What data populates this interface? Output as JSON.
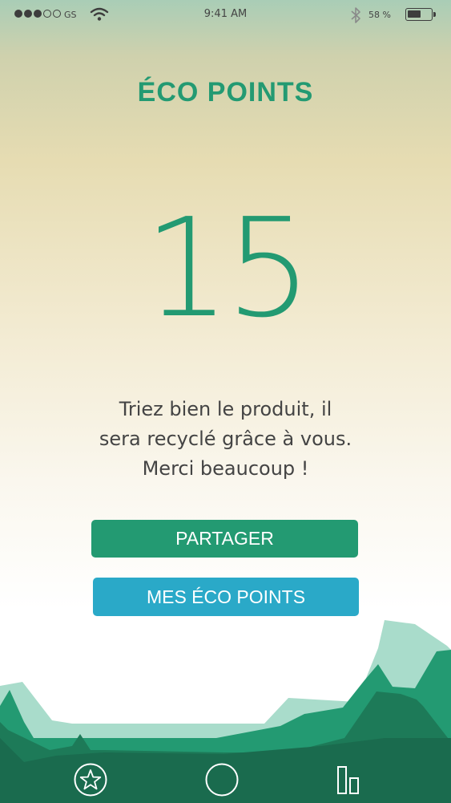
{
  "status_bar": {
    "signal_full": 3,
    "signal_empty": 2,
    "carrier": "GS",
    "time": "9:41 AM",
    "battery_percent_label": "58 %",
    "battery_level": 0.58
  },
  "screen": {
    "title": "ÉCO POINTS",
    "points": "15",
    "message_lines": [
      "Triez bien le produit, il",
      "sera recyclé grâce à vous.",
      "Merci beaucoup !"
    ]
  },
  "buttons": {
    "share_label": "PARTAGER",
    "eco_points_label": "MES ÉCO POINTS"
  },
  "nav": {
    "items": [
      "star-icon",
      "circle-icon",
      "bars-icon"
    ]
  },
  "colors": {
    "primary_green": "#239a72",
    "accent_blue": "#2aa9c8",
    "dark_green": "#1a6b4e",
    "light_green": "#a9dccb"
  }
}
